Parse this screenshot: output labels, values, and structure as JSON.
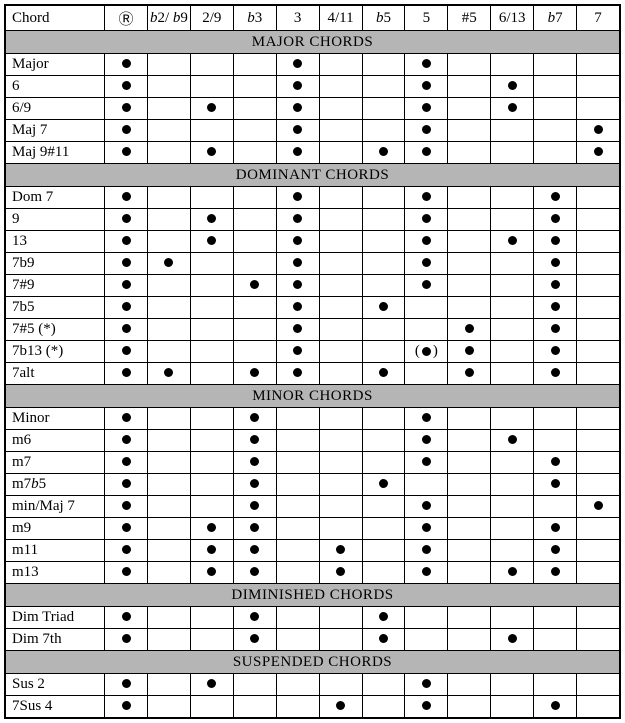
{
  "chart_data": {
    "type": "table",
    "title": "Chord tone reference",
    "columns": [
      "Chord",
      "R",
      "b2/b9",
      "2/9",
      "b3",
      "3",
      "4/11",
      "b5",
      "5",
      "#5",
      "6/13",
      "b7",
      "7"
    ],
    "sections": [
      {
        "heading": "MAJOR CHORDS",
        "rows": [
          {
            "name": "Major",
            "tones": [
              "R",
              "3",
              "5"
            ]
          },
          {
            "name": "6",
            "tones": [
              "R",
              "3",
              "5",
              "6/13"
            ]
          },
          {
            "name": "6/9",
            "tones": [
              "R",
              "2/9",
              "3",
              "5",
              "6/13"
            ]
          },
          {
            "name": "Maj 7",
            "tones": [
              "R",
              "3",
              "5",
              "7"
            ]
          },
          {
            "name": "Maj 9#11",
            "tones": [
              "R",
              "2/9",
              "3",
              "b5",
              "5",
              "7"
            ]
          }
        ]
      },
      {
        "heading": "DOMINANT CHORDS",
        "rows": [
          {
            "name": "Dom 7",
            "tones": [
              "R",
              "3",
              "5",
              "b7"
            ]
          },
          {
            "name": "9",
            "tones": [
              "R",
              "2/9",
              "3",
              "5",
              "b7"
            ]
          },
          {
            "name": "13",
            "tones": [
              "R",
              "2/9",
              "3",
              "5",
              "6/13",
              "b7"
            ]
          },
          {
            "name": "7b9",
            "tones": [
              "R",
              "b2/b9",
              "3",
              "5",
              "b7"
            ]
          },
          {
            "name": "7#9",
            "tones": [
              "R",
              "b3",
              "3",
              "5",
              "b7"
            ]
          },
          {
            "name": "7b5",
            "tones": [
              "R",
              "3",
              "b5",
              "b7"
            ]
          },
          {
            "name": "7#5 (*)",
            "tones": [
              "R",
              "3",
              "#5",
              "b7"
            ]
          },
          {
            "name": "7b13 (*)",
            "tones": [
              "R",
              "3",
              "#5",
              "b7"
            ],
            "optional": [
              "5"
            ]
          },
          {
            "name": "7alt",
            "tones": [
              "R",
              "b2/b9",
              "b3",
              "3",
              "b5",
              "#5",
              "b7"
            ]
          }
        ]
      },
      {
        "heading": "MINOR CHORDS",
        "rows": [
          {
            "name": "Minor",
            "tones": [
              "R",
              "b3",
              "5"
            ]
          },
          {
            "name": "m6",
            "tones": [
              "R",
              "b3",
              "5",
              "6/13"
            ]
          },
          {
            "name": "m7",
            "tones": [
              "R",
              "b3",
              "5",
              "b7"
            ]
          },
          {
            "name": "m7b5",
            "tones": [
              "R",
              "b3",
              "b5",
              "b7"
            ]
          },
          {
            "name": "min/Maj 7",
            "tones": [
              "R",
              "b3",
              "5",
              "7"
            ]
          },
          {
            "name": "m9",
            "tones": [
              "R",
              "2/9",
              "b3",
              "5",
              "b7"
            ]
          },
          {
            "name": "m11",
            "tones": [
              "R",
              "2/9",
              "b3",
              "4/11",
              "5",
              "b7"
            ]
          },
          {
            "name": "m13",
            "tones": [
              "R",
              "2/9",
              "b3",
              "4/11",
              "5",
              "6/13",
              "b7"
            ]
          }
        ]
      },
      {
        "heading": "DIMINISHED CHORDS",
        "rows": [
          {
            "name": "Dim Triad",
            "tones": [
              "R",
              "b3",
              "b5"
            ]
          },
          {
            "name": "Dim 7th",
            "tones": [
              "R",
              "b3",
              "b5",
              "6/13"
            ]
          }
        ]
      },
      {
        "heading": "SUSPENDED CHORDS",
        "rows": [
          {
            "name": "Sus 2",
            "tones": [
              "R",
              "2/9",
              "5"
            ]
          },
          {
            "name": "7Sus 4",
            "tones": [
              "R",
              "4/11",
              "5",
              "b7"
            ]
          }
        ]
      }
    ]
  },
  "col_keys": [
    "R",
    "b2/b9",
    "2/9",
    "b3",
    "3",
    "4/11",
    "b5",
    "5",
    "#5",
    "6/13",
    "b7",
    "7"
  ],
  "col_labels": {
    "chord": "Chord",
    "R": "Ⓡ",
    "b2/b9": "<span class=\"ital\">b</span>2/ <span class=\"ital\">b</span>9",
    "2/9": "2/9",
    "b3": "<span class=\"ital\">b</span>3",
    "3": "3",
    "4/11": "4/11",
    "b5": "<span class=\"ital\">b</span>5",
    "5": "5",
    "#5": "#5",
    "6/13": "6/13",
    "b7": "<span class=\"ital\">b</span>7",
    "7": "7"
  },
  "row_labels": {
    "m7b5": "m7<span class=\"ital\">b</span>5"
  }
}
